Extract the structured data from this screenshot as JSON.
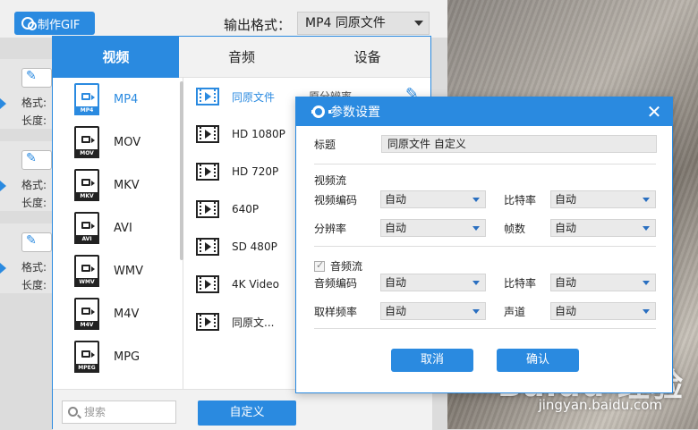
{
  "toolbar": {
    "gif_label": "制作GIF",
    "output_format_label": "输出格式：",
    "output_format_value": "MP4  同原文件"
  },
  "bg_items": [
    {
      "l1": "格式:",
      "l2": "长度:"
    },
    {
      "l1": "格式:",
      "l2": "长度:"
    },
    {
      "l1": "格式:",
      "l2": "长度:"
    }
  ],
  "picker": {
    "tabs": [
      "视频",
      "音频",
      "设备"
    ],
    "formats": [
      {
        "label": "MP4",
        "tag": "MP4"
      },
      {
        "label": "MOV",
        "tag": "MOV"
      },
      {
        "label": "MKV",
        "tag": "MKV"
      },
      {
        "label": "AVI",
        "tag": "AVI"
      },
      {
        "label": "WMV",
        "tag": "WMV"
      },
      {
        "label": "M4V",
        "tag": "M4V"
      },
      {
        "label": "MPG",
        "tag": "MPEG"
      }
    ],
    "presets": [
      {
        "label": "同原文件",
        "res": "原分辨率"
      },
      {
        "label": "HD 1080P"
      },
      {
        "label": "HD 720P"
      },
      {
        "label": "640P"
      },
      {
        "label": "SD 480P"
      },
      {
        "label": "4K Video"
      },
      {
        "label": "同原文..."
      }
    ],
    "search_placeholder": "搜索",
    "custom_label": "自定义"
  },
  "dialog": {
    "title": "参数设置",
    "title_label": "标题",
    "title_value": "同原文件 自定义",
    "video_stream": "视频流",
    "video_codec_label": "视频编码",
    "video_codec_value": "自动",
    "video_bitrate_label": "比特率",
    "video_bitrate_value": "自动",
    "resolution_label": "分辨率",
    "resolution_value": "自动",
    "framerate_label": "帧数",
    "framerate_value": "自动",
    "audio_stream": "音频流",
    "audio_codec_label": "音频编码",
    "audio_codec_value": "自动",
    "audio_bitrate_label": "比特率",
    "audio_bitrate_value": "自动",
    "samplerate_label": "取样频率",
    "samplerate_value": "自动",
    "channel_label": "声道",
    "channel_value": "自动",
    "cancel_label": "取消",
    "confirm_label": "确认"
  },
  "watermark": {
    "logo": "Baidu 经验",
    "url": "jingyan.baidu.com"
  },
  "colors": {
    "accent": "#2a8ae0"
  }
}
